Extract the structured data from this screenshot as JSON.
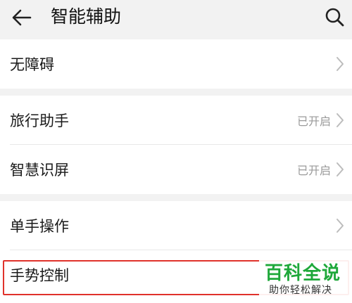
{
  "header": {
    "title": "智能辅助",
    "back_icon": "arrow-left-icon",
    "search_icon": "search-icon"
  },
  "groups": [
    {
      "items": [
        {
          "label": "无障碍",
          "status": ""
        }
      ]
    },
    {
      "items": [
        {
          "label": "旅行助手",
          "status": "已开启"
        },
        {
          "label": "智慧识屏",
          "status": "已开启"
        }
      ]
    },
    {
      "items": [
        {
          "label": "单手操作",
          "status": ""
        },
        {
          "label": "手势控制",
          "status": ""
        }
      ]
    }
  ],
  "watermark": {
    "title": "百科全说",
    "subtitle": "助你轻松解决"
  },
  "colors": {
    "highlight": "#e0322b",
    "watermark_green": "#1fa83a",
    "status_gray": "#9a9a9a"
  }
}
